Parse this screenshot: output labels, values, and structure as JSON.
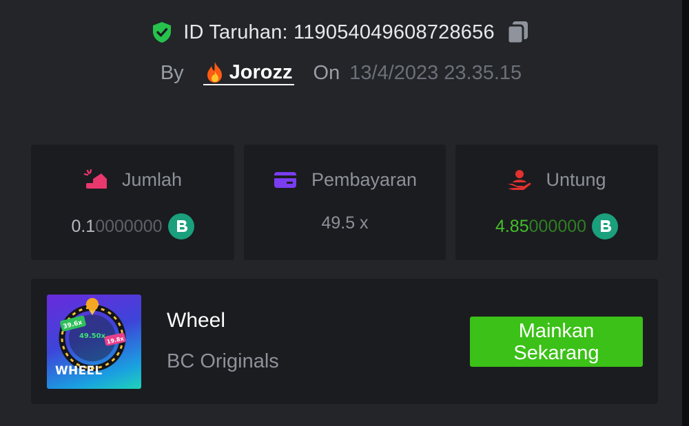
{
  "bet": {
    "id_label": "ID Taruhan: 119054049608728656",
    "by_label": "By",
    "username": "Jorozz",
    "on_label": "On",
    "date": "13/4/2023 23.35.15"
  },
  "stats": {
    "amount": {
      "label": "Jumlah",
      "value_main": "0.1",
      "value_tail": "0000000",
      "icon": "bet-amount-icon",
      "color": "#e8386e"
    },
    "payout": {
      "label": "Pembayaran",
      "value": "49.5 x",
      "icon": "card-icon",
      "color": "#7a3df0"
    },
    "profit": {
      "label": "Untung",
      "value_main": "4.85",
      "value_tail": "000000",
      "icon": "profit-hand-icon",
      "color": "#e2312f"
    }
  },
  "game": {
    "thumb_title": "WHEEL",
    "thumb_labels": [
      "39.6x",
      "49.50x",
      "19.8x"
    ],
    "name": "Wheel",
    "provider": "BC Originals",
    "play_label": "Mainkan\nSekarang"
  },
  "colors": {
    "accent_green": "#3bc117",
    "profit_green": "#43c02a",
    "coin_teal": "#1aa07c"
  }
}
